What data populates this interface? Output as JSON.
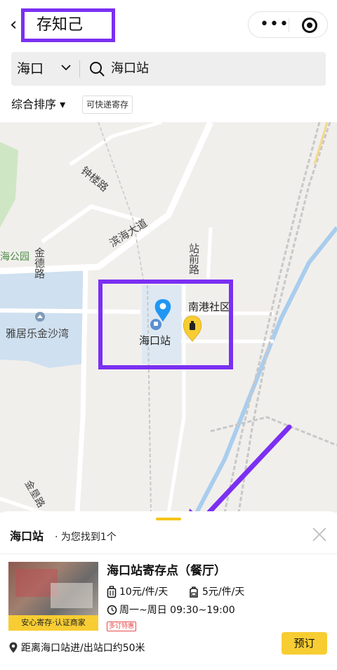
{
  "header": {
    "title": "存知己",
    "back_glyph": "‹",
    "more_glyph": "•••"
  },
  "search": {
    "city": "海口",
    "query": "海口站"
  },
  "filters": {
    "sort_label": "综合排序 ▾",
    "express_tag": "可快递寄存"
  },
  "map": {
    "labels": {
      "road_1": "钟楼路",
      "road_2": "滨海大道",
      "road_3": "金德路",
      "road_4": "站前路",
      "road_5": "金垦路",
      "park": "海公园",
      "community": "南港社区",
      "residential": "雅居乐金沙湾",
      "station": "海口站"
    },
    "colors": {
      "water": "#cfe0f0",
      "green": "#cfe6c4",
      "railway": "#b9b9b9",
      "marker": "#2196f3",
      "shop_marker": "#f7cd33"
    }
  },
  "sheet": {
    "station": "海口站",
    "count_text": "· 为您找到1个",
    "shop": {
      "name": "海口站寄存点（餐厅）",
      "badge": "安心寄存·认证商家",
      "price_luggage": "10元/件/天",
      "price_bag": "5元/件/天",
      "hours": "周一~周日 09:30~19:00",
      "promo": "多订特惠",
      "distance": "距离海口站进/出站口约50米",
      "book_label": "预订"
    }
  },
  "annotations": {
    "highlight_color": "#7b2ff2"
  }
}
